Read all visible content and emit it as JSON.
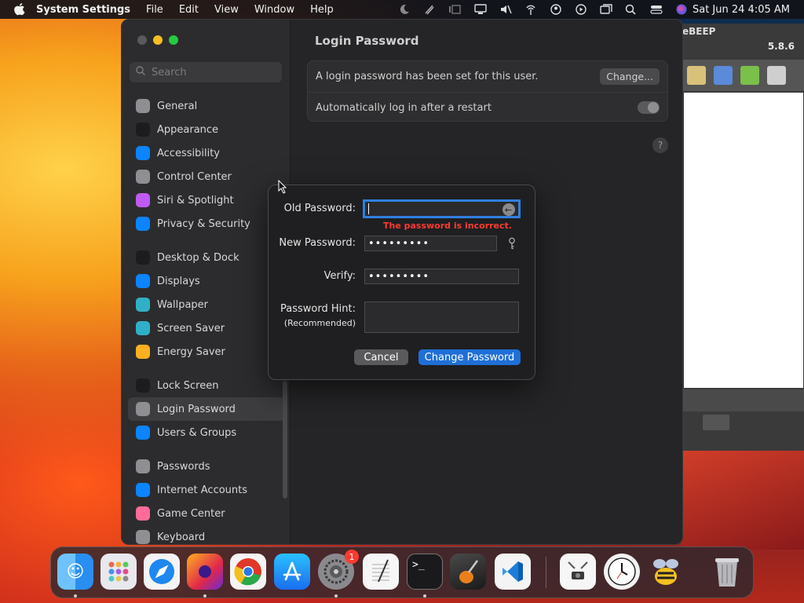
{
  "menubar": {
    "app_name": "System Settings",
    "menus": [
      "File",
      "Edit",
      "View",
      "Window",
      "Help"
    ],
    "clock": "Sat Jun 24  4:05 AM"
  },
  "settings": {
    "search_placeholder": "Search",
    "sidebar": [
      {
        "label": "General",
        "icon": "gear-icon",
        "color": "#8e8e93"
      },
      {
        "label": "Appearance",
        "icon": "appearance-icon",
        "color": "#1c1c1e"
      },
      {
        "label": "Accessibility",
        "icon": "accessibility-icon",
        "color": "#0a84ff"
      },
      {
        "label": "Control Center",
        "icon": "control-center-icon",
        "color": "#8e8e93"
      },
      {
        "label": "Siri & Spotlight",
        "icon": "siri-icon",
        "color": "#bf5af2"
      },
      {
        "label": "Privacy & Security",
        "icon": "hand-icon",
        "color": "#0a84ff"
      },
      {
        "label": "Desktop & Dock",
        "icon": "desktop-icon",
        "color": "#1c1c1e"
      },
      {
        "label": "Displays",
        "icon": "displays-icon",
        "color": "#0a84ff"
      },
      {
        "label": "Wallpaper",
        "icon": "wallpaper-icon",
        "color": "#30b0c7"
      },
      {
        "label": "Screen Saver",
        "icon": "screen-saver-icon",
        "color": "#30b0c7"
      },
      {
        "label": "Energy Saver",
        "icon": "energy-icon",
        "color": "#ffb020"
      },
      {
        "label": "Lock Screen",
        "icon": "lock-icon",
        "color": "#1c1c1e"
      },
      {
        "label": "Login Password",
        "icon": "login-password-icon",
        "color": "#8e8e93"
      },
      {
        "label": "Users & Groups",
        "icon": "users-icon",
        "color": "#0a84ff"
      },
      {
        "label": "Passwords",
        "icon": "key-icon",
        "color": "#8e8e93"
      },
      {
        "label": "Internet Accounts",
        "icon": "at-icon",
        "color": "#0a84ff"
      },
      {
        "label": "Game Center",
        "icon": "game-center-icon",
        "color": "#ff6b9a"
      },
      {
        "label": "Keyboard",
        "icon": "keyboard-icon",
        "color": "#8e8e93"
      }
    ],
    "selected_index": 12,
    "title": "Login Password",
    "password_row": "A login password has been set for this user.",
    "change_button": "Change...",
    "autologin_row": "Automatically log in after a restart",
    "help": "?"
  },
  "beep": {
    "title": "eBEEP",
    "version": "5.8.6"
  },
  "dialog": {
    "old_label": "Old Password:",
    "error": "The password is incorrect.",
    "new_label": "New Password:",
    "new_value": "•••••••••",
    "verify_label": "Verify:",
    "verify_value": "•••••••••",
    "hint_label": "Password Hint:",
    "hint_sub": "(Recommended)",
    "cancel": "Cancel",
    "ok": "Change Password"
  },
  "dock": {
    "settings_badge": "1"
  },
  "colors": {
    "accent": "#1f6fd6",
    "error": "#ff3b30",
    "focus_ring": "#2f7fe0"
  }
}
